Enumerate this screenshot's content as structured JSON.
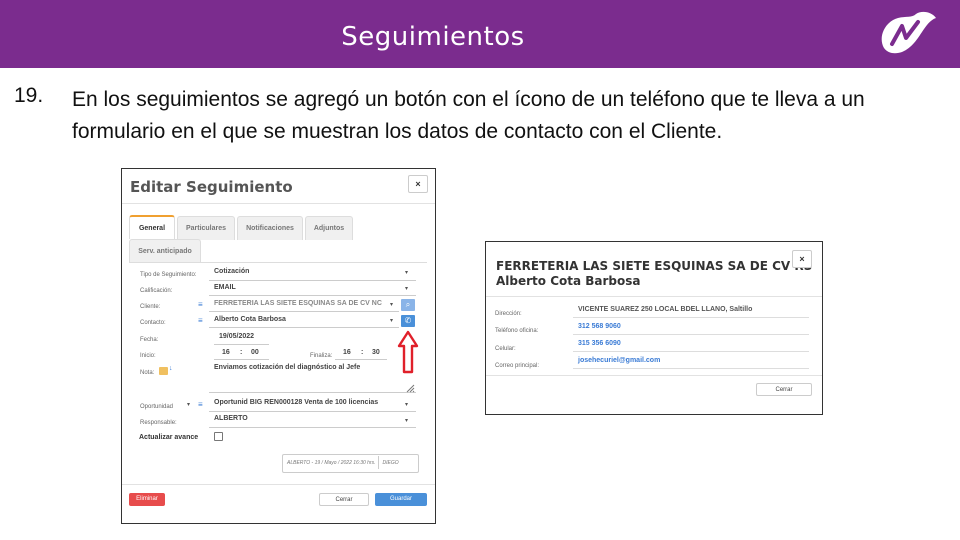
{
  "slide": {
    "title": "Seguimientos",
    "point_number": "19.",
    "point_text": "En los seguimientos se agregó un botón con el ícono de un teléfono que te lleva a un formulario en el que se muestran los datos de contacto con el Cliente."
  },
  "edit_modal": {
    "title": "Editar Seguimiento",
    "close": "×",
    "tabs": [
      "General",
      "Particulares",
      "Notificaciones",
      "Adjuntos",
      "Serv. anticipado"
    ],
    "fields": {
      "tipo_label": "Tipo de Seguimiento:",
      "tipo_value": "Cotización",
      "calif_label": "Calificación:",
      "calif_value": "EMAIL",
      "cliente_label": "Cliente:",
      "cliente_value": "FERRETERIA LAS SIETE ESQUINAS SA DE CV NC",
      "contacto_label": "Contacto:",
      "contacto_value": "Alberto Cota Barbosa",
      "fecha_label": "Fecha:",
      "fecha_value": "19/05/2022",
      "inicio_label": "Inicio:",
      "inicio_h": "16",
      "inicio_m": "00",
      "colon": ":",
      "final_label": "Finaliza:",
      "final_h": "16",
      "final_m": "30",
      "nota_label": "Nota:",
      "nota_value": "Enviamos cotización del diagnóstico al Jefe",
      "oport_label": "Oportunidad",
      "oport_value": "Oportunid BIG REN000128 Venta de 100 licencias",
      "resp_label": "Responsable:",
      "resp_value": "ALBERTO",
      "avance_label": "Actualizar avance"
    },
    "audit_text": "ALBERTO - 19 / Mayo / 2022 16:30 hrs.",
    "audit_user": "DIEGO",
    "buttons": {
      "delete": "Eliminar",
      "close": "Cerrar",
      "save": "Guardar"
    }
  },
  "contact_modal": {
    "title_line1": "FERRETERIA LAS SIETE ESQUINAS SA DE CV RS",
    "title_line2": "Alberto Cota Barbosa",
    "close": "×",
    "rows": [
      {
        "label": "Dirección:",
        "value": "VICENTE SUAREZ 250 LOCAL BDEL LLANO, Saltillo"
      },
      {
        "label": "Teléfono oficina:",
        "value": "312 568 9060"
      },
      {
        "label": "Celular:",
        "value": "315 356 6090"
      },
      {
        "label": "Correo principal:",
        "value": "josehecuriel@gmail.com"
      }
    ],
    "close_button": "Cerrar"
  },
  "colors": {
    "banner": "#7b2c8e",
    "accent_blue": "#4a90d9",
    "danger": "#e74c4c",
    "arrow": "#e0202a"
  }
}
